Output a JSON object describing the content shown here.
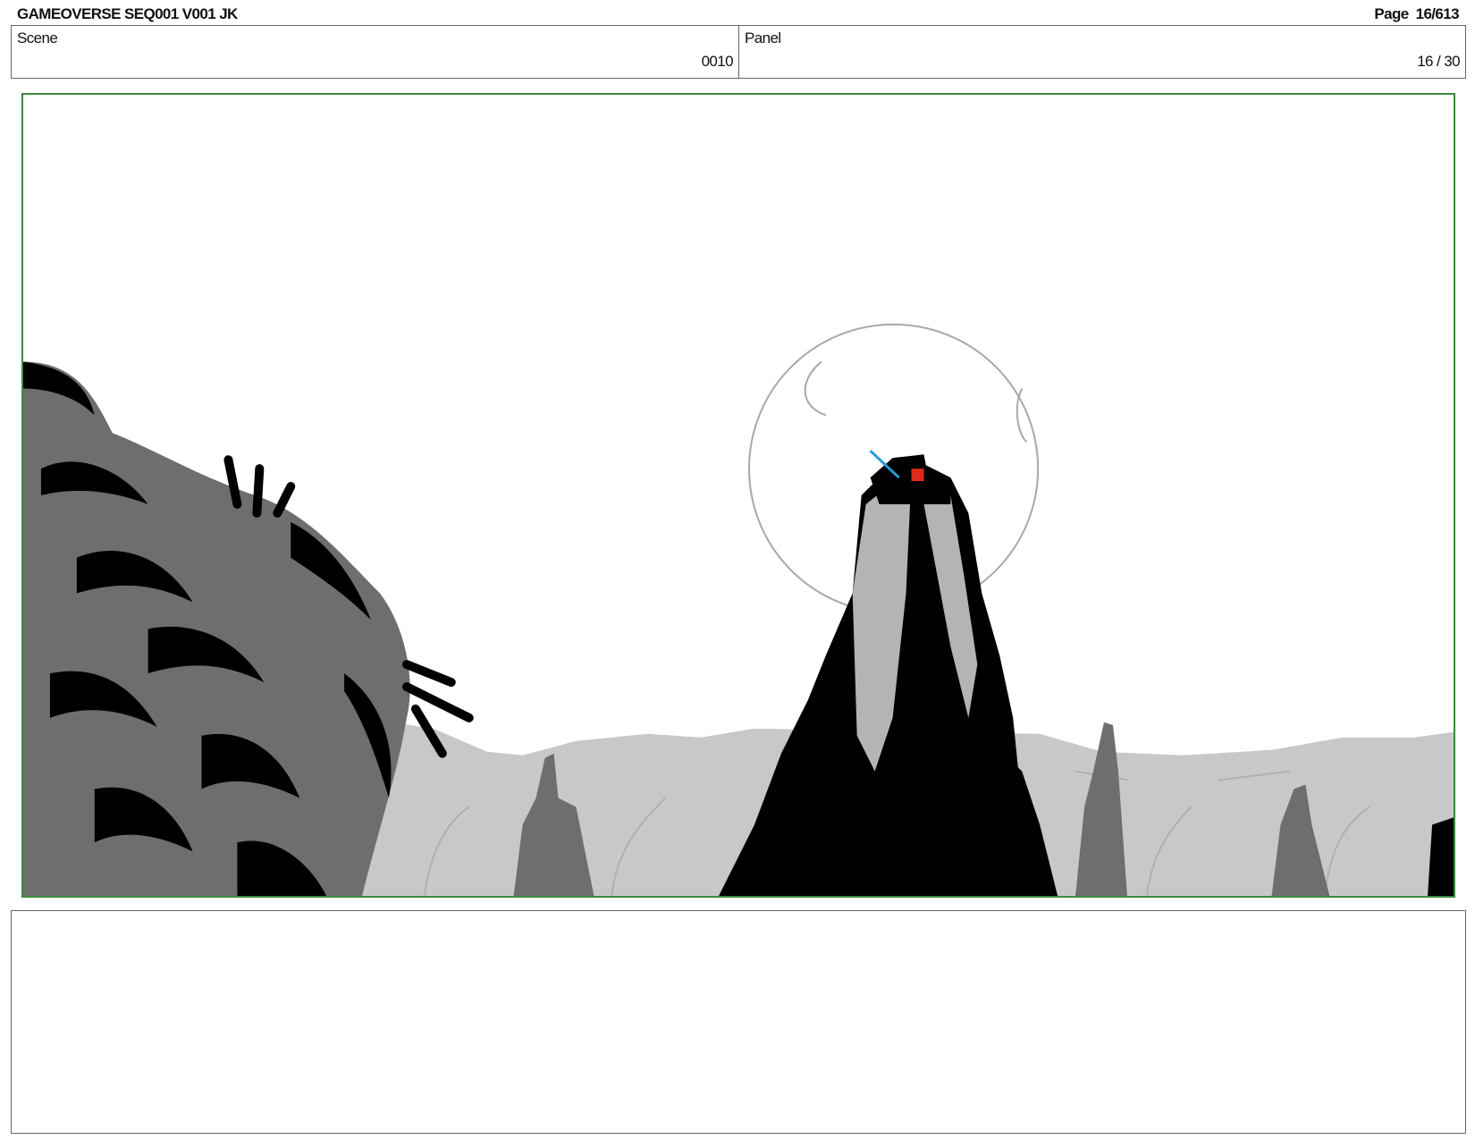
{
  "header": {
    "title": "GAMEOVERSE SEQ001 V001 JK",
    "page_label": "Page",
    "page_number": "16/613"
  },
  "info": {
    "scene_label": "Scene",
    "scene_value": "0010",
    "panel_label": "Panel",
    "panel_value": "16 / 30"
  },
  "colors": {
    "frame_border": "#3c8a3c",
    "ink": "#000000",
    "mid_gray": "#6e6e6e",
    "light_gray": "#c8c8c8",
    "accent_red": "#e02a1a",
    "accent_blue": "#2a9ad8"
  },
  "notes": {
    "text": ""
  }
}
